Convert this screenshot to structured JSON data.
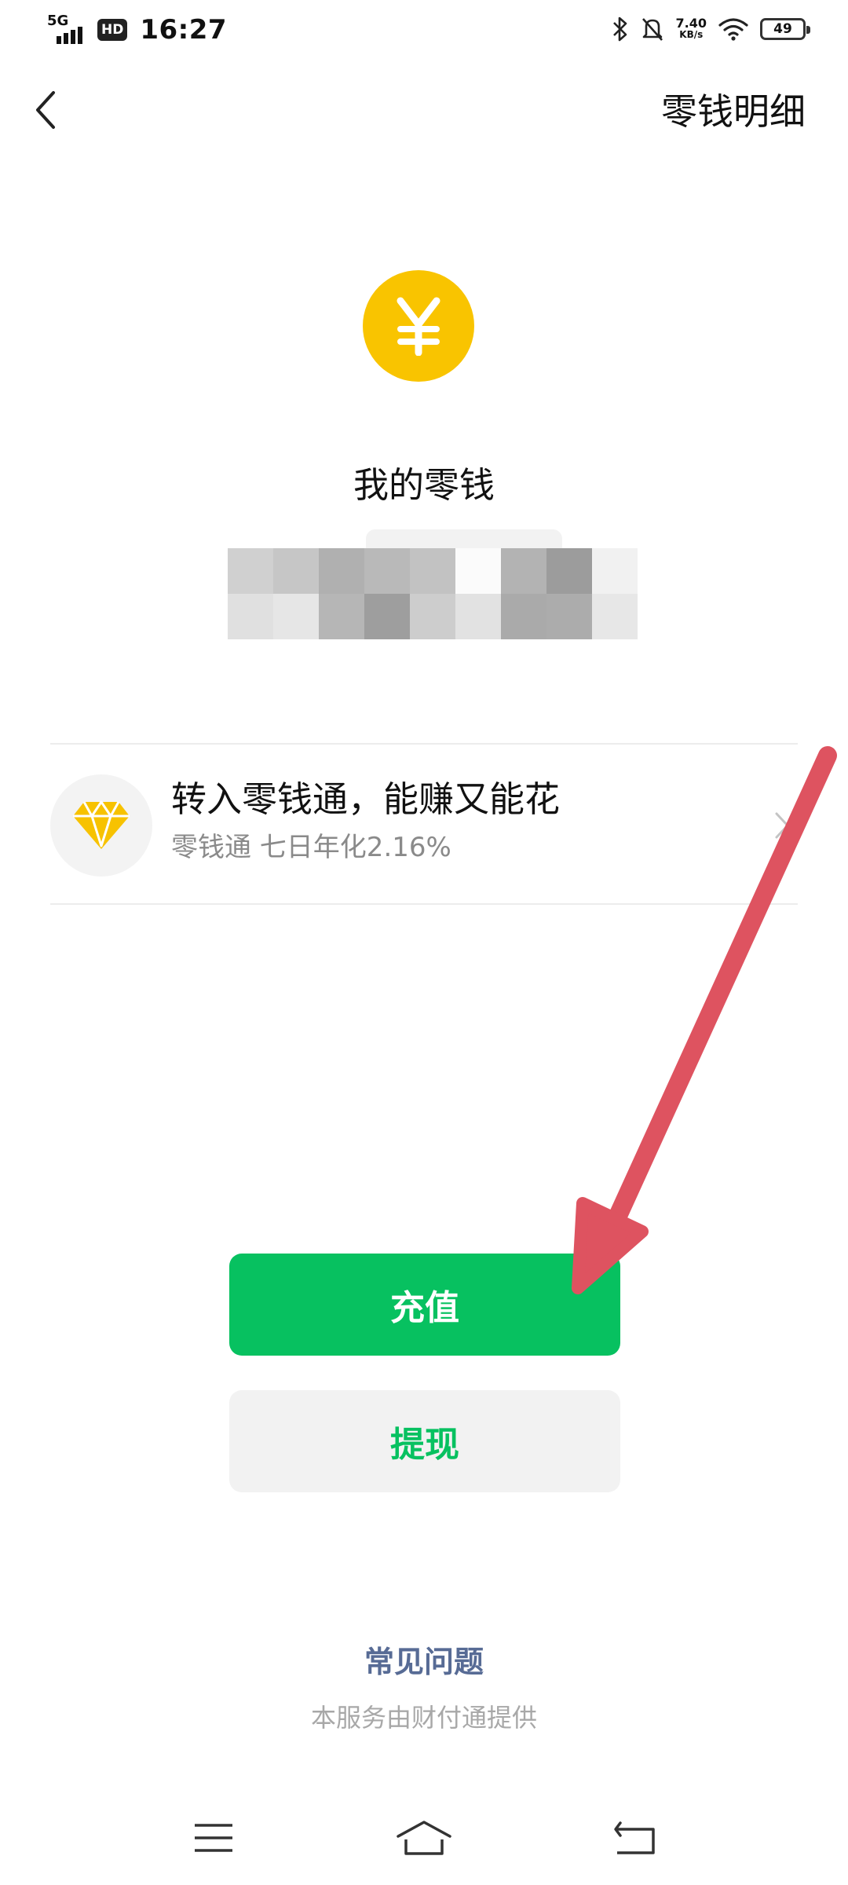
{
  "status_bar": {
    "network": "5G",
    "hd": "HD",
    "time": "16:27",
    "speed_value": "7.40",
    "speed_unit": "KB/s",
    "battery": "49",
    "icons": [
      "bluetooth-icon",
      "mute-icon",
      "wifi-icon",
      "battery-icon"
    ]
  },
  "nav": {
    "back_icon": "chevron-left-icon",
    "detail_link": "零钱明细"
  },
  "wallet": {
    "coin_symbol": "¥",
    "title": "我的零钱",
    "balance_symbol": "¥",
    "balance_hidden": true
  },
  "promo": {
    "icon": "diamond-icon",
    "title": "转入零钱通，能赚又能花",
    "subtitle": "零钱通 七日年化2.16%",
    "chevron_icon": "chevron-right-icon"
  },
  "buttons": {
    "recharge": "充值",
    "withdraw": "提现"
  },
  "footer": {
    "faq": "常见问题",
    "provider": "本服务由财付通提供"
  },
  "system_nav": {
    "menu_icon": "menu-icon",
    "home_icon": "home-icon",
    "back_icon": "back-icon"
  },
  "colors": {
    "brand_green": "#07c160",
    "coin_yellow": "#f9c400",
    "link_blue": "#576b95",
    "annotation_red": "#de5360"
  }
}
